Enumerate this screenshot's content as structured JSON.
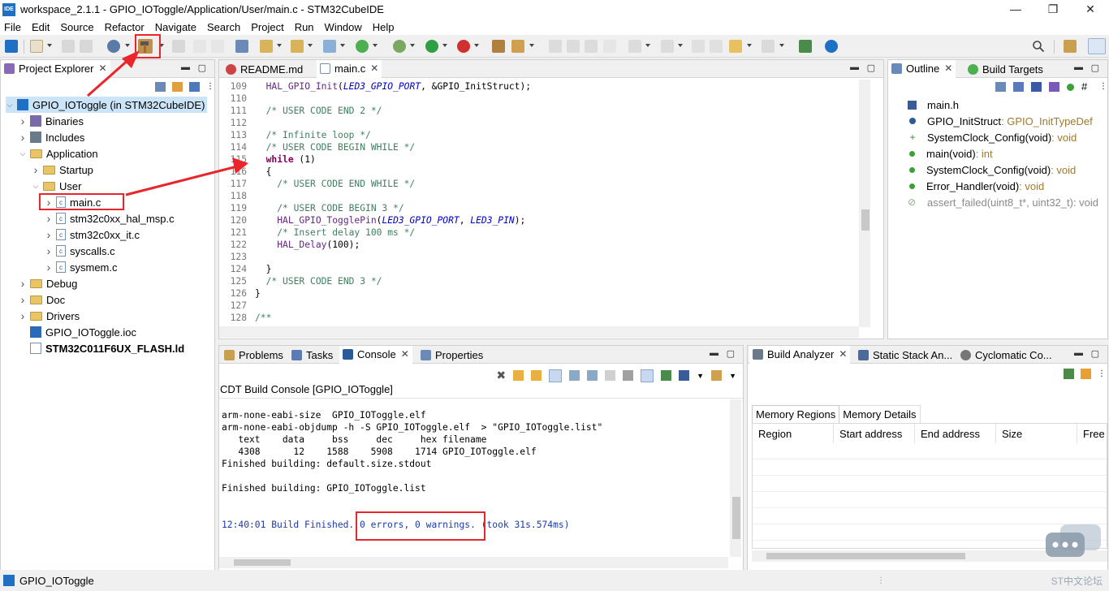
{
  "window": {
    "title": "workspace_2.1.1 - GPIO_IOToggle/Application/User/main.c - STM32CubeIDE",
    "app_icon": "IDE",
    "minimize": "—",
    "restore": "❐",
    "close": "✕"
  },
  "menu": [
    "File",
    "Edit",
    "Source",
    "Refactor",
    "Navigate",
    "Search",
    "Project",
    "Run",
    "Window",
    "Help"
  ],
  "project_explorer": {
    "tab_label": "Project Explorer",
    "tree": [
      {
        "label": "GPIO_IOToggle (in STM32CubeIDE)",
        "depth": 0,
        "state": "open",
        "kind": "project"
      },
      {
        "label": "Binaries",
        "depth": 1,
        "state": "closed",
        "kind": "binaries"
      },
      {
        "label": "Includes",
        "depth": 1,
        "state": "closed",
        "kind": "includes"
      },
      {
        "label": "Application",
        "depth": 1,
        "state": "open",
        "kind": "folder"
      },
      {
        "label": "Startup",
        "depth": 2,
        "state": "closed",
        "kind": "folder"
      },
      {
        "label": "User",
        "depth": 2,
        "state": "open",
        "kind": "folder"
      },
      {
        "label": "main.c",
        "depth": 3,
        "state": "closed",
        "kind": "cfile"
      },
      {
        "label": "stm32c0xx_hal_msp.c",
        "depth": 3,
        "state": "closed",
        "kind": "cfile"
      },
      {
        "label": "stm32c0xx_it.c",
        "depth": 3,
        "state": "closed",
        "kind": "cfile"
      },
      {
        "label": "syscalls.c",
        "depth": 3,
        "state": "closed",
        "kind": "cfile"
      },
      {
        "label": "sysmem.c",
        "depth": 3,
        "state": "closed",
        "kind": "cfile"
      },
      {
        "label": "Debug",
        "depth": 1,
        "state": "closed",
        "kind": "folder"
      },
      {
        "label": "Doc",
        "depth": 1,
        "state": "closed",
        "kind": "folder"
      },
      {
        "label": "Drivers",
        "depth": 1,
        "state": "closed",
        "kind": "folder"
      },
      {
        "label": "GPIO_IOToggle.ioc",
        "depth": 1,
        "state": "none",
        "kind": "ioc"
      },
      {
        "label": "STM32C011F6UX_FLASH.ld",
        "depth": 1,
        "state": "none",
        "kind": "ld"
      }
    ]
  },
  "editor": {
    "tabs": [
      "README.md",
      "main.c"
    ],
    "lines": [
      {
        "n": "109",
        "code": "  HAL_GPIO_Init(LED3_GPIO_PORT, &GPIO_InitStruct);"
      },
      {
        "n": "110",
        "code": ""
      },
      {
        "n": "111",
        "code": "  /* USER CODE END 2 */"
      },
      {
        "n": "112",
        "code": ""
      },
      {
        "n": "113",
        "code": "  /* Infinite loop */"
      },
      {
        "n": "114",
        "code": "  /* USER CODE BEGIN WHILE */"
      },
      {
        "n": "115",
        "code": "  while (1)"
      },
      {
        "n": "116",
        "code": "  {"
      },
      {
        "n": "117",
        "code": "    /* USER CODE END WHILE */"
      },
      {
        "n": "118",
        "code": ""
      },
      {
        "n": "119",
        "code": "    /* USER CODE BEGIN 3 */"
      },
      {
        "n": "120",
        "code": "    HAL_GPIO_TogglePin(LED3_GPIO_PORT, LED3_PIN);"
      },
      {
        "n": "121",
        "code": "    /* Insert delay 100 ms */"
      },
      {
        "n": "122",
        "code": "    HAL_Delay(100);"
      },
      {
        "n": "123",
        "code": ""
      },
      {
        "n": "124",
        "code": "  }"
      },
      {
        "n": "125",
        "code": "  /* USER CODE END 3 */"
      },
      {
        "n": "126",
        "code": "}"
      },
      {
        "n": "127",
        "code": ""
      },
      {
        "n": "128",
        "code": "/**"
      }
    ]
  },
  "console": {
    "tabs": [
      "Problems",
      "Tasks",
      "Console",
      "Properties"
    ],
    "title": "CDT Build Console [GPIO_IOToggle]",
    "lines": [
      "arm-none-eabi-size  GPIO_IOToggle.elf",
      "arm-none-eabi-objdump -h -S GPIO_IOToggle.elf  > \"GPIO_IOToggle.list\"",
      "   text    data     bss     dec     hex filename",
      "   4308      12    1588    5908    1714 GPIO_IOToggle.elf",
      "Finished building: default.size.stdout",
      "",
      "Finished building: GPIO_IOToggle.list",
      "",
      ""
    ],
    "final_prefix": "12:40:01 Build Finished. ",
    "final_result": "0 errors, 0 warnings.",
    "final_suffix": " (took 31s.574ms)"
  },
  "outline": {
    "tabs": [
      "Outline",
      "Build Targets"
    ],
    "items": [
      {
        "name": "main.h",
        "type": "",
        "kind": "header"
      },
      {
        "name": "GPIO_InitStruct",
        "type": " : GPIO_InitTypeDef",
        "kind": "static"
      },
      {
        "name": "SystemClock_Config(void)",
        "type": " : void",
        "kind": "decl"
      },
      {
        "name": "main(void)",
        "type": " : int",
        "kind": "func"
      },
      {
        "name": "SystemClock_Config(void)",
        "type": " : void",
        "kind": "func"
      },
      {
        "name": "Error_Handler(void)",
        "type": " : void",
        "kind": "func"
      },
      {
        "name": "assert_failed(uint8_t*, uint32_t)",
        "type": " : void",
        "kind": "disabled"
      }
    ]
  },
  "analyzer": {
    "tabs": [
      "Build Analyzer",
      "Static Stack An...",
      "Cyclomatic Co..."
    ],
    "subtabs": [
      "Memory Regions",
      "Memory Details"
    ],
    "columns": [
      "Region",
      "Start address",
      "End address",
      "Size",
      "Free"
    ]
  },
  "status": {
    "project": "GPIO_IOToggle",
    "watermark": "ST中文论坛"
  },
  "colors": {
    "highlight_red": "#e8262b",
    "keyword": "#7f0055",
    "comment": "#3f7f5f",
    "console_blue": "#1c3aa8"
  }
}
